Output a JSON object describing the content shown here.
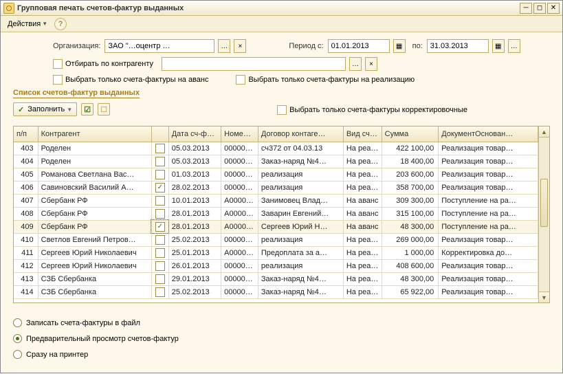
{
  "window": {
    "title": "Групповая печать счетов-фактур выданных"
  },
  "menu": {
    "actions": "Действия"
  },
  "form": {
    "org_label": "Организация:",
    "org_value": "ЗАО \"…оцентр …",
    "period_from_label": "Период с:",
    "period_from": "01.01.2013",
    "period_to_label": "по:",
    "period_to": "31.03.2013",
    "filter_by_contr": "Отбирать по контрагенту",
    "only_advance": "Выбрать  только  счета-фактуры  на  аванс",
    "only_sale": "Выбрать  только  счета-фактуры  на  реализацию",
    "only_corr": "Выбрать  только  счета-фактуры  корректировочные",
    "section": "Список счетов-фактур выданных",
    "fill_btn": "Заполнить"
  },
  "columns": {
    "np": "п/п",
    "contr": "Контрагент",
    "cb": "",
    "date": "Дата сч-фа…",
    "num": "Номер…",
    "dog": "Договор контаге…",
    "vid": "Вид сче…",
    "sum": "Сумма",
    "doc": "ДокументОснован…"
  },
  "rows": [
    {
      "np": "403",
      "contr": "Роделен",
      "cb": false,
      "date": "05.03.2013",
      "num": "00000…",
      "dog": "сч372 от 04.03.13",
      "vid": "На реа…",
      "sum": "422 100,00",
      "doc": "Реализация товар…"
    },
    {
      "np": "404",
      "contr": "Роделен",
      "cb": false,
      "date": "05.03.2013",
      "num": "00000…",
      "dog": "Заказ-наряд №4…",
      "vid": "На реа…",
      "sum": "18 400,00",
      "doc": "Реализация товар…"
    },
    {
      "np": "405",
      "contr": "Романова Светлана Вас…",
      "cb": false,
      "date": "01.03.2013",
      "num": "00000…",
      "dog": "реализация",
      "vid": "На реа…",
      "sum": "203 600,00",
      "doc": "Реализация товар…"
    },
    {
      "np": "406",
      "contr": "Савиновский Василий А…",
      "cb": true,
      "date": "28.02.2013",
      "num": "00000…",
      "dog": "реализация",
      "vid": "На реа…",
      "sum": "358 700,00",
      "doc": "Реализация товар…"
    },
    {
      "np": "407",
      "contr": "Сбербанк РФ",
      "cb": false,
      "date": "10.01.2013",
      "num": "А0000…",
      "dog": "Занимовец Влад…",
      "vid": "На аванс",
      "sum": "309 300,00",
      "doc": "Поступление на ра…"
    },
    {
      "np": "408",
      "contr": "Сбербанк РФ",
      "cb": false,
      "date": "28.01.2013",
      "num": "А0000…",
      "dog": "Заварин Евгений…",
      "vid": "На аванс",
      "sum": "315 100,00",
      "doc": "Поступление на ра…"
    },
    {
      "np": "409",
      "contr": "Сбербанк РФ",
      "cb": true,
      "date": "28.01.2013",
      "num": "А0000…",
      "dog": "Сергеев Юрий Н…",
      "vid": "На аванс",
      "sum": "48 300,00",
      "doc": "Поступление на ра…",
      "selected": true
    },
    {
      "np": "410",
      "contr": "Светлов Евгений Петров…",
      "cb": false,
      "date": "25.02.2013",
      "num": "00000…",
      "dog": "реализация",
      "vid": "На реа…",
      "sum": "269 000,00",
      "doc": "Реализация товар…"
    },
    {
      "np": "411",
      "contr": "Сергеев Юрий Николаевич",
      "cb": false,
      "date": "25.01.2013",
      "num": "А0000…",
      "dog": "Предоплата за а…",
      "vid": "На реа…",
      "sum": "1 000,00",
      "doc": "Корректировка до…"
    },
    {
      "np": "412",
      "contr": "Сергеев Юрий Николаевич",
      "cb": false,
      "date": "26.01.2013",
      "num": "00000…",
      "dog": "реализация",
      "vid": "На реа…",
      "sum": "408 600,00",
      "doc": "Реализация товар…"
    },
    {
      "np": "413",
      "contr": "СЗБ Сбербанка",
      "cb": false,
      "date": "29.01.2013",
      "num": "00000…",
      "dog": "Заказ-наряд №4…",
      "vid": "На реа…",
      "sum": "48 300,00",
      "doc": "Реализация товар…"
    },
    {
      "np": "414",
      "contr": "СЗБ Сбербанка",
      "cb": false,
      "date": "25.02.2013",
      "num": "00000…",
      "dog": "Заказ-наряд №4…",
      "vid": "На реа…",
      "sum": "65 922,00",
      "doc": "Реализация товар…"
    }
  ],
  "output": {
    "to_file": "Записать счета-фактуры в файл",
    "preview": "Предварительный просмотр счетов-фактур",
    "printer": "Сразу на принтер",
    "selected": "preview"
  }
}
